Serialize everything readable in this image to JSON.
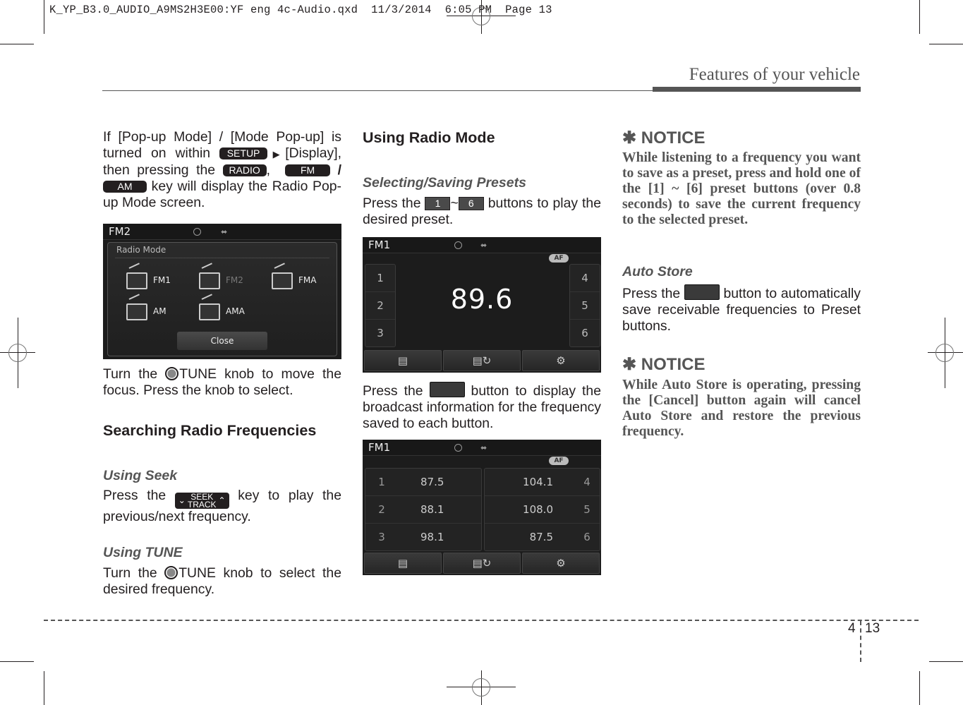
{
  "slug": "K_YP_B3.0_AUDIO_A9MS2H3E00:YF eng 4c-Audio.qxd  11/3/2014  6:05 PM  Page 13",
  "running_head": "Features of your vehicle",
  "footer": {
    "chapter": "4",
    "page": "13"
  },
  "col1": {
    "intro": {
      "t1": "If [Pop-up Mode] / [Mode Pop-up] is turned on within ",
      "setup_key": "SETUP",
      "t2": "[Display], then pressing the ",
      "radio_key": "RADIO",
      "comma": ",",
      "fm_key": "FM",
      "slash": "/",
      "am_key": "AM",
      "t3": " key will display the Radio Pop-up Mode screen."
    },
    "popup_screen": {
      "band": "FM2",
      "title": "Radio Mode",
      "modes": [
        "FM1",
        "FM2",
        "FMA",
        "AM",
        "AMA"
      ],
      "close_label": "Close"
    },
    "tune_para": {
      "t1": "Turn the ",
      "t2": "TUNE knob to move the focus. Press the knob to select."
    },
    "section_title": "Searching Radio Frequencies",
    "seek": {
      "title": "Using Seek",
      "t1": "Press the ",
      "key_top": "SEEK",
      "key_bottom": "TRACK",
      "t2": " key to play the previous/next frequency."
    },
    "tune": {
      "title": "Using TUNE",
      "t1": "Turn the ",
      "t2": "TUNE knob to select the desired frequency."
    }
  },
  "col2": {
    "section_title": "Using Radio Mode",
    "presets": {
      "title": "Selecting/Saving Presets",
      "t1": "Press the ",
      "key_start": "1",
      "tilde": "~",
      "key_end": "6",
      "t2": " buttons to play the desired preset."
    },
    "radio_screen": {
      "band": "FM1",
      "af_label": "AF",
      "frequency": "89.6",
      "left_presets": [
        "1",
        "2",
        "3"
      ],
      "right_presets": [
        "4",
        "5",
        "6"
      ]
    },
    "info_para": {
      "t1": "Press the ",
      "t2": " button to display the broadcast information for the frequency saved to each button."
    },
    "list_screen": {
      "band": "FM1",
      "af_label": "AF",
      "left": [
        {
          "num": "1",
          "freq": "87.5"
        },
        {
          "num": "2",
          "freq": "88.1"
        },
        {
          "num": "3",
          "freq": "98.1"
        }
      ],
      "right": [
        {
          "num": "4",
          "freq": "104.1"
        },
        {
          "num": "5",
          "freq": "108.0"
        },
        {
          "num": "6",
          "freq": "87.5"
        }
      ]
    }
  },
  "col3": {
    "notice1": {
      "title": "✱ NOTICE",
      "text": "While listening to a frequency you want to save as a preset, press and hold one of the [1] ~ [6] preset buttons (over 0.8 seconds) to save the current frequency to the selected preset."
    },
    "autostore": {
      "title": "Auto Store",
      "t1": "Press the ",
      "t2": " button to automatically save receivable frequencies to Preset buttons."
    },
    "notice2": {
      "title": "✱ NOTICE",
      "text": "While Auto Store is operating, pressing the [Cancel] button again will cancel Auto Store and restore the previous frequency."
    }
  }
}
